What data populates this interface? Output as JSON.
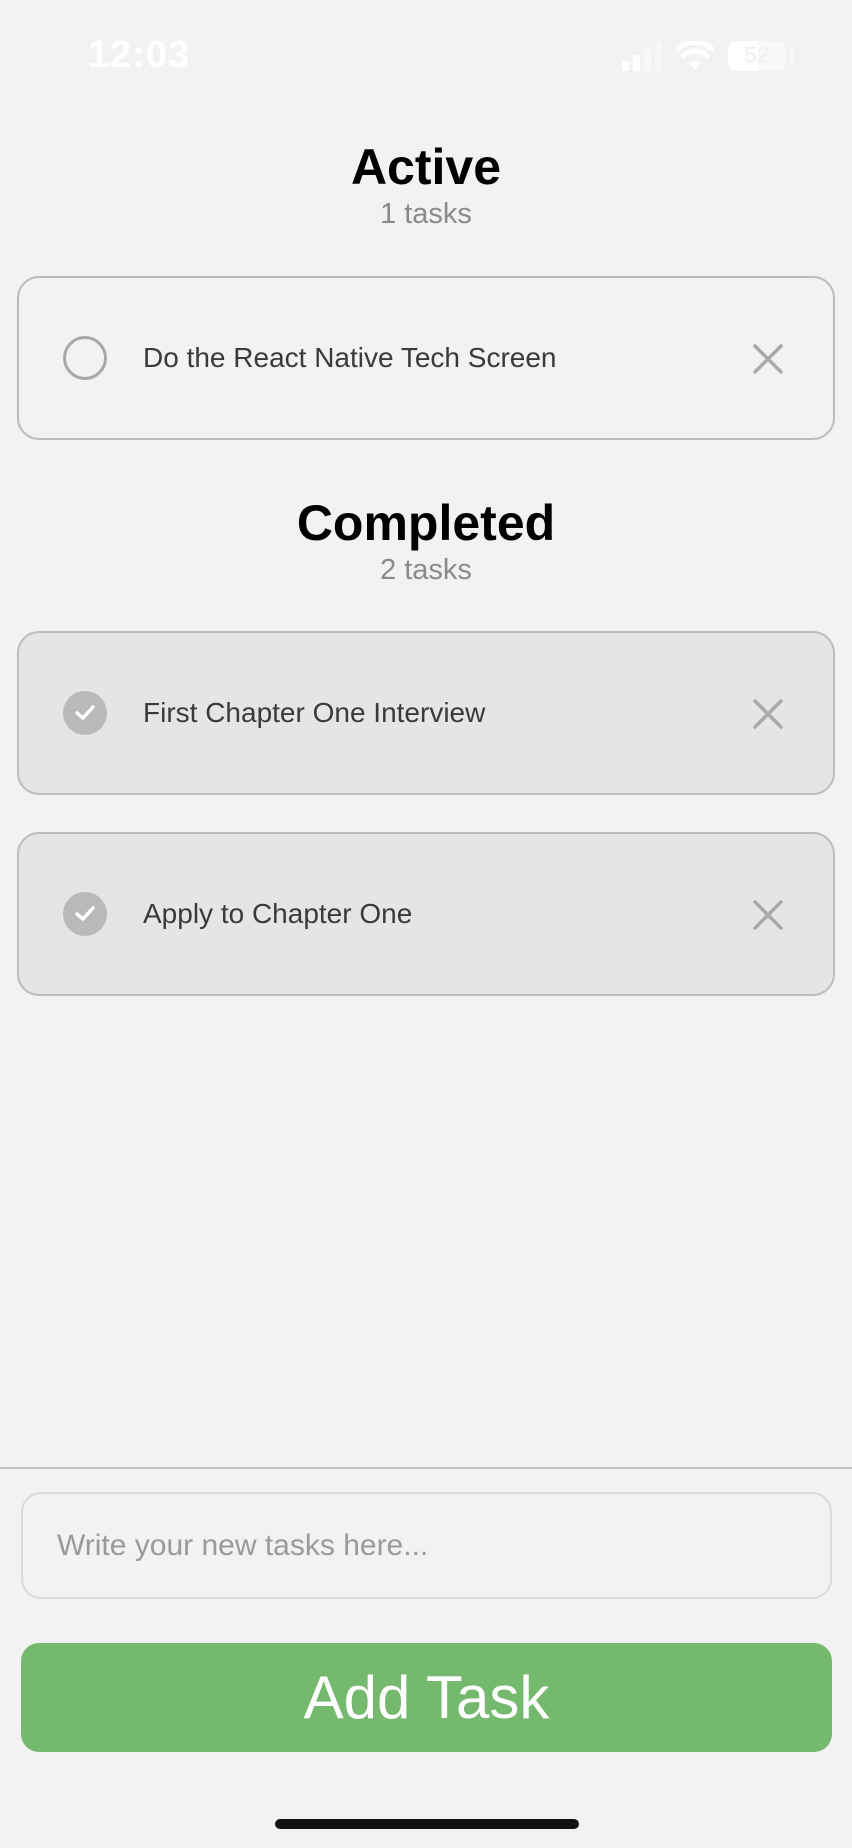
{
  "status_bar": {
    "time": "12:03",
    "battery_level": "52"
  },
  "active": {
    "title": "Active",
    "count_label": "1 tasks",
    "tasks": [
      {
        "label": "Do the React Native Tech Screen",
        "completed": false
      }
    ]
  },
  "completed": {
    "title": "Completed",
    "count_label": "2 tasks",
    "tasks": [
      {
        "label": "First Chapter One Interview",
        "completed": true
      },
      {
        "label": "Apply to Chapter One",
        "completed": true
      }
    ]
  },
  "composer": {
    "input_placeholder": "Write your new tasks here...",
    "input_value": "",
    "add_button_label": "Add Task"
  },
  "colors": {
    "background": "#f2f2f2",
    "accent": "#74b96e",
    "completed_card": "#e5e5e5",
    "check_done": "#b9b9b9"
  },
  "icons": {
    "unchecked": "circle-outline-icon",
    "checked": "check-circle-icon",
    "delete": "close-icon",
    "signal": "cellular-signal-icon",
    "wifi": "wifi-icon",
    "battery": "battery-icon"
  }
}
